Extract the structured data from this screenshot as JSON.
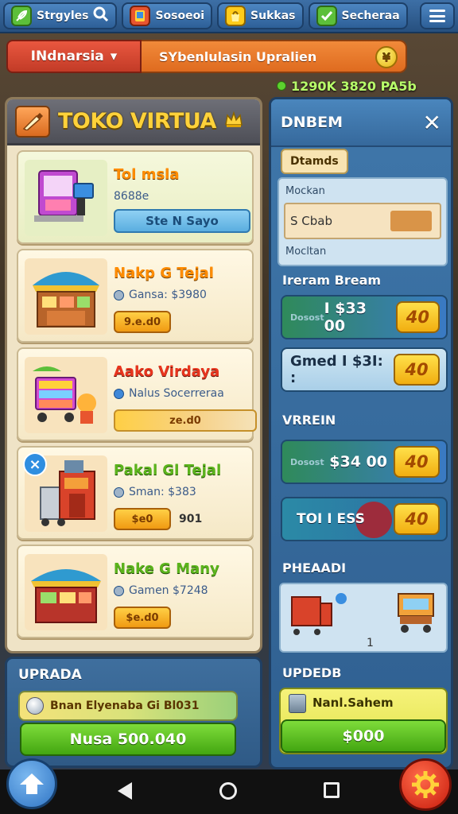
{
  "topbar": {
    "tabs": [
      {
        "label": "Strgyles",
        "icon": "search-icon"
      },
      {
        "label": "Sosoeoi",
        "icon": "tablet-icon"
      },
      {
        "label": "Sukkas",
        "icon": "bag-icon"
      },
      {
        "label": "Secheraa",
        "icon": "check-icon"
      }
    ],
    "menu_icon": "menu-icon"
  },
  "region": {
    "label": "INdnarsia",
    "chevron": "▾"
  },
  "mission": {
    "label": "SYbenlulasin Upralien",
    "coin_glyph": "¥"
  },
  "money": {
    "value": "1290K 3820 PA5b"
  },
  "shop": {
    "title": "TOKO VIRTUA",
    "items": [
      {
        "name": "Tol msla",
        "sub": "8688e",
        "button": "Ste N Sayo"
      },
      {
        "name": "Nakp G Tejal",
        "sub": "Gansa: $3980",
        "button": "9.e.d0"
      },
      {
        "name": "Aako Virdaya",
        "sub": "Nalus Socerreraa",
        "button": "ze.d0"
      },
      {
        "name": "Pakal Gl Tejal",
        "sub": "Sman: $383",
        "button": "$e0",
        "note": "901"
      },
      {
        "name": "Nake G Many",
        "sub": "Gamen $7248",
        "button": "$e.d0"
      }
    ]
  },
  "upgrade_left": {
    "title": "UPRADA",
    "bar_text": "Bnan Elyenaba Gi Bl031",
    "button": "Nusa 500.040"
  },
  "right_panel": {
    "title": "DNBEM",
    "tag": "Dtamds",
    "box_top": "Mockan",
    "box_field": "S Cbab",
    "box_bottom": "Mocltan",
    "section1": "Ireram Bream",
    "row1": {
      "lbl": "Dosost",
      "amount": "I $33 00",
      "btn": "40"
    },
    "row2": {
      "amount": "Gmed I $3I: :",
      "btn": "40"
    },
    "section2": "VRREIN",
    "row3": {
      "lbl": "Dosost",
      "amount": "$34 00",
      "btn": "40"
    },
    "row4": {
      "amount": "TOI I ESS",
      "btn": "40"
    },
    "section3": "PHEAADI",
    "scene_num": "1",
    "section4": "UPDEDB",
    "upd_label": "Nanl.Sahem",
    "upd_button": "$000"
  }
}
